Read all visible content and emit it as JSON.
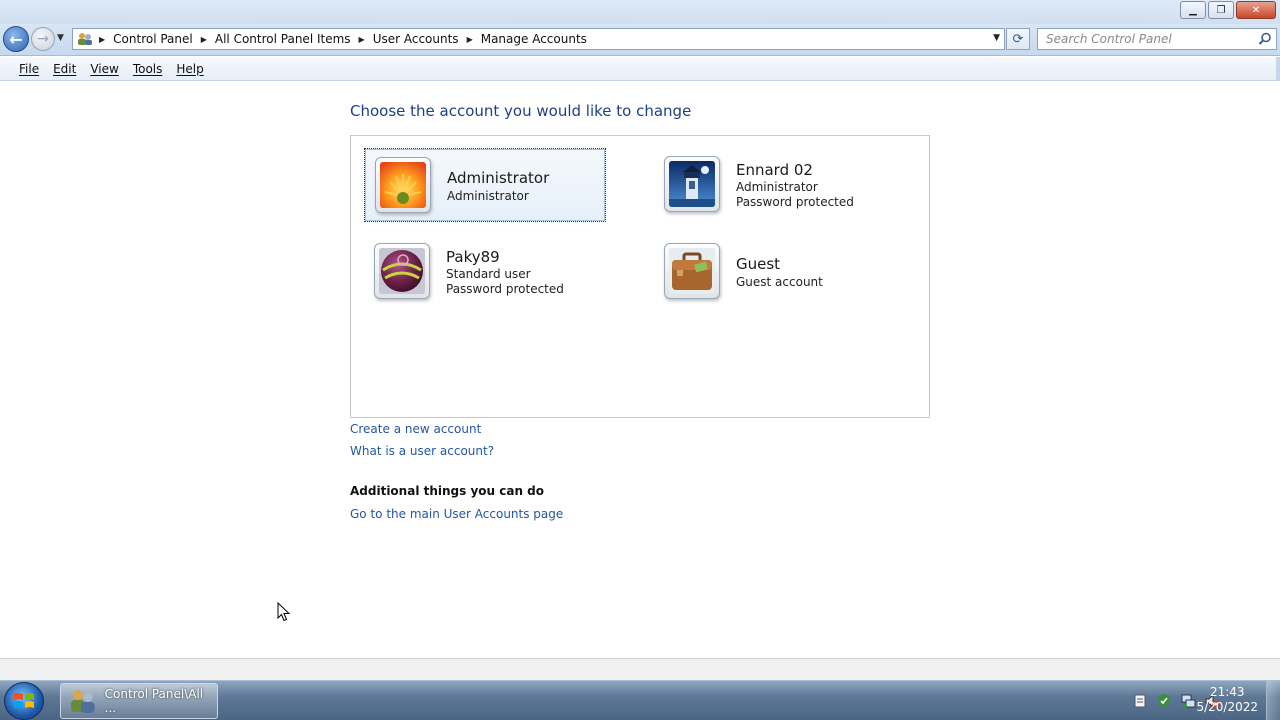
{
  "window": {
    "minimize_glyph": "▁",
    "maximize_glyph": "❐",
    "close_glyph": "✕"
  },
  "nav": {
    "back_glyph": "←",
    "forward_glyph": "→",
    "dropdown_glyph": "▼",
    "breadcrumbs": [
      "Control Panel",
      "All Control Panel Items",
      "User Accounts",
      "Manage Accounts"
    ],
    "refresh_glyph": "⟳",
    "search_placeholder": "Search Control Panel"
  },
  "menu": {
    "items": [
      "File",
      "Edit",
      "View",
      "Tools",
      "Help"
    ]
  },
  "main": {
    "heading": "Choose the account you would like to change",
    "accounts": [
      {
        "name": "Administrator",
        "lines": [
          "Administrator"
        ],
        "icon": "flower-icon",
        "selected": true
      },
      {
        "name": "Ennard 02",
        "lines": [
          "Administrator",
          "Password protected"
        ],
        "icon": "lighthouse-icon",
        "selected": false
      },
      {
        "name": "Paky89",
        "lines": [
          "Standard user",
          "Password protected"
        ],
        "icon": "ball-icon",
        "selected": false
      },
      {
        "name": "Guest",
        "lines": [
          "Guest account"
        ],
        "icon": "briefcase-icon",
        "selected": false
      }
    ],
    "links": {
      "create": "Create a new account",
      "what_is": "What is a user account?"
    },
    "additional_heading": "Additional things you can do",
    "additional_links": [
      "Go to the main User Accounts page"
    ]
  },
  "taskbar": {
    "window_button_label": "Control Panel\\All ...",
    "clock_time": "21:43",
    "clock_date": "5/20/2022"
  }
}
